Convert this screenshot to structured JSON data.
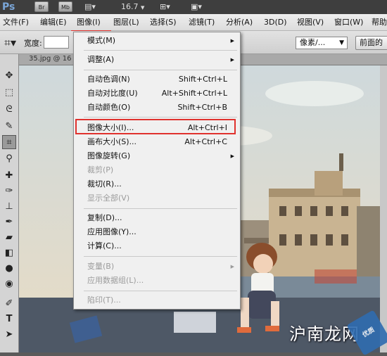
{
  "app": {
    "logo": "Ps",
    "buttons": [
      "Br",
      "Mb"
    ],
    "zoom": "16.7",
    "zoom_arrow": "▼"
  },
  "menubar": {
    "items": [
      "文件(F)",
      "编辑(E)",
      "图像(I)",
      "图层(L)",
      "选择(S)",
      "滤镜(T)",
      "分析(A)",
      "3D(D)",
      "视图(V)",
      "窗口(W)",
      "帮助"
    ]
  },
  "options_bar": {
    "width_label": "宽度:",
    "unit_select": "像素/...",
    "front_image_button": "前面的"
  },
  "document": {
    "tab_title": "35.jpg @ 16"
  },
  "image_menu": {
    "items": [
      {
        "label": "模式(M)",
        "shortcut": "",
        "submenu": true,
        "disabled": false
      },
      {
        "label": "调整(A)",
        "shortcut": "",
        "submenu": true,
        "disabled": false
      },
      {
        "label": "自动色调(N)",
        "shortcut": "Shift+Ctrl+L",
        "submenu": false,
        "disabled": false
      },
      {
        "label": "自动对比度(U)",
        "shortcut": "Alt+Shift+Ctrl+L",
        "submenu": false,
        "disabled": false
      },
      {
        "label": "自动颜色(O)",
        "shortcut": "Shift+Ctrl+B",
        "submenu": false,
        "disabled": false
      },
      {
        "label": "图像大小(I)...",
        "shortcut": "Alt+Ctrl+I",
        "submenu": false,
        "disabled": false,
        "highlighted": true
      },
      {
        "label": "画布大小(S)...",
        "shortcut": "Alt+Ctrl+C",
        "submenu": false,
        "disabled": false
      },
      {
        "label": "图像旋转(G)",
        "shortcut": "",
        "submenu": true,
        "disabled": false
      },
      {
        "label": "裁剪(P)",
        "shortcut": "",
        "submenu": false,
        "disabled": true
      },
      {
        "label": "裁切(R)...",
        "shortcut": "",
        "submenu": false,
        "disabled": false
      },
      {
        "label": "显示全部(V)",
        "shortcut": "",
        "submenu": false,
        "disabled": true
      },
      {
        "label": "复制(D)...",
        "shortcut": "",
        "submenu": false,
        "disabled": false
      },
      {
        "label": "应用图像(Y)...",
        "shortcut": "",
        "submenu": false,
        "disabled": false
      },
      {
        "label": "计算(C)...",
        "shortcut": "",
        "submenu": false,
        "disabled": false
      },
      {
        "label": "变量(B)",
        "shortcut": "",
        "submenu": true,
        "disabled": true
      },
      {
        "label": "应用数据组(L)...",
        "shortcut": "",
        "submenu": false,
        "disabled": true
      },
      {
        "label": "陷印(T)...",
        "shortcut": "",
        "submenu": false,
        "disabled": true
      }
    ]
  },
  "watermark": {
    "text": "沪南龙网",
    "badge": "优质"
  },
  "colors": {
    "highlight_border": "#e0322e",
    "menubar_bg": "#e6e6e6",
    "app_bar_bg": "#3e3e3e"
  },
  "icons": [
    "crop-icon",
    "move-icon",
    "marquee-icon",
    "lasso-icon",
    "quick-select-icon",
    "eyedropper-icon",
    "healing-icon",
    "brush-icon",
    "stamp-icon",
    "history-brush-icon",
    "eraser-icon",
    "gradient-icon",
    "blur-icon",
    "dodge-icon",
    "pen-icon",
    "type-icon",
    "path-select-icon",
    "shape-icon",
    "hand-icon",
    "zoom-icon",
    "submenu-arrow-icon",
    "chevron-down-icon"
  ]
}
